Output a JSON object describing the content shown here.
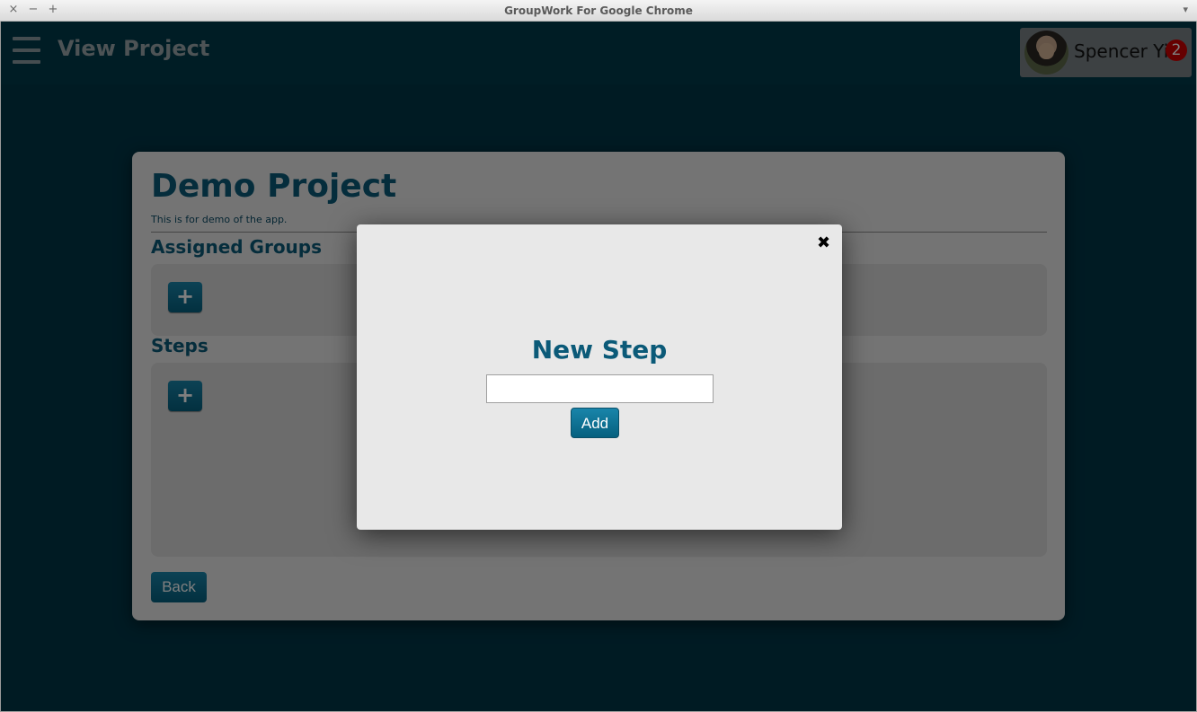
{
  "window": {
    "title": "GroupWork For Google Chrome",
    "close_glyph": "×",
    "minimize_glyph": "−",
    "maximize_glyph": "+",
    "menu_glyph": "▾"
  },
  "header": {
    "title": "View Project",
    "menu_icon": "hamburger-icon",
    "user": {
      "name": "Spencer Yi",
      "notification_count": "2"
    }
  },
  "project": {
    "title": "Demo Project",
    "description": "This is for demo of the app.",
    "sections": {
      "groups_label": "Assigned Groups",
      "steps_label": "Steps"
    },
    "add_glyph": "+",
    "back_label": "Back"
  },
  "modal": {
    "title": "New Step",
    "close_glyph": "✖",
    "input_value": "",
    "add_label": "Add"
  },
  "colors": {
    "app_background": "#003647",
    "accent": "#0b5a78",
    "button": "#05607f",
    "badge": "#cc0000"
  }
}
